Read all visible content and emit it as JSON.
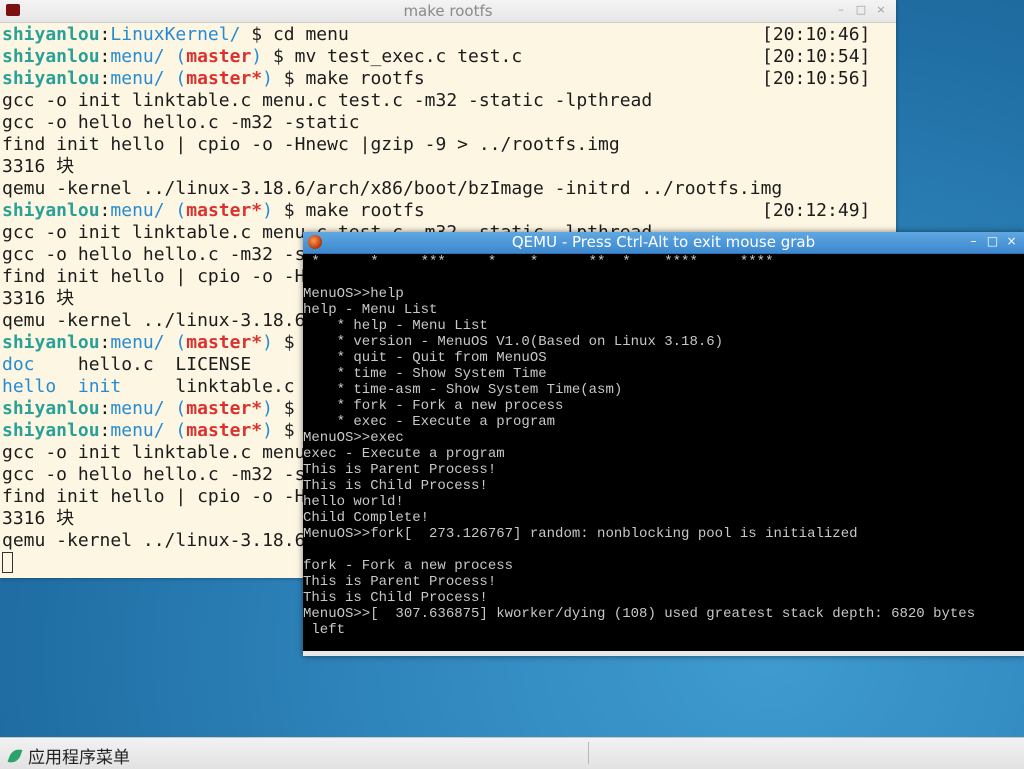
{
  "terminal": {
    "title": "make rootfs",
    "buttons": {
      "minimize": "–",
      "maximize": "□",
      "close": "×"
    },
    "lines": [
      {
        "segs": [
          {
            "t": "shiyanlou",
            "c": "green"
          },
          {
            "t": ":",
            "c": "plain"
          },
          {
            "t": "LinuxKernel/",
            "c": "blue"
          },
          {
            "t": " $ cd menu",
            "c": "plain"
          }
        ],
        "ts": "[20:10:46]"
      },
      {
        "segs": [
          {
            "t": "shiyanlou",
            "c": "green"
          },
          {
            "t": ":",
            "c": "plain"
          },
          {
            "t": "menu/",
            "c": "blue"
          },
          {
            "t": " (",
            "c": "blue"
          },
          {
            "t": "master",
            "c": "red"
          },
          {
            "t": ")",
            "c": "blue"
          },
          {
            "t": " $ mv test_exec.c test.c",
            "c": "plain"
          }
        ],
        "ts": "[20:10:54]"
      },
      {
        "segs": [
          {
            "t": "shiyanlou",
            "c": "green"
          },
          {
            "t": ":",
            "c": "plain"
          },
          {
            "t": "menu/",
            "c": "blue"
          },
          {
            "t": " (",
            "c": "blue"
          },
          {
            "t": "master*",
            "c": "red"
          },
          {
            "t": ")",
            "c": "blue"
          },
          {
            "t": " $ make rootfs",
            "c": "plain"
          }
        ],
        "ts": "[20:10:56]"
      },
      {
        "segs": [
          {
            "t": "gcc -o init linktable.c menu.c test.c -m32 -static -lpthread",
            "c": "plain"
          }
        ]
      },
      {
        "segs": [
          {
            "t": "gcc -o hello hello.c -m32 -static",
            "c": "plain"
          }
        ]
      },
      {
        "segs": [
          {
            "t": "find init hello | cpio -o -Hnewc |gzip -9 > ../rootfs.img",
            "c": "plain"
          }
        ]
      },
      {
        "segs": [
          {
            "t": "3316 块",
            "c": "plain"
          }
        ]
      },
      {
        "segs": [
          {
            "t": "qemu -kernel ../linux-3.18.6/arch/x86/boot/bzImage -initrd ../rootfs.img",
            "c": "plain"
          }
        ]
      },
      {
        "segs": [
          {
            "t": "shiyanlou",
            "c": "green"
          },
          {
            "t": ":",
            "c": "plain"
          },
          {
            "t": "menu/",
            "c": "blue"
          },
          {
            "t": " (",
            "c": "blue"
          },
          {
            "t": "master*",
            "c": "red"
          },
          {
            "t": ")",
            "c": "blue"
          },
          {
            "t": " $ make rootfs",
            "c": "plain"
          }
        ],
        "ts": "[20:12:49]"
      },
      {
        "segs": [
          {
            "t": "gcc -o init linktable.c menu.c test.c -m32 -static -lpthread",
            "c": "plain"
          }
        ]
      },
      {
        "segs": [
          {
            "t": "gcc -o hello hello.c -m32 -static",
            "c": "plain"
          }
        ]
      },
      {
        "segs": [
          {
            "t": "find init hello | cpio -o -Hnewc |gzip -9 > ../rootfs.img",
            "c": "plain"
          }
        ]
      },
      {
        "segs": [
          {
            "t": "3316 块",
            "c": "plain"
          }
        ]
      },
      {
        "segs": [
          {
            "t": "qemu -kernel ../linux-3.18.6/arch/x86/boot/bzImage -initrd ../rootfs.img",
            "c": "plain"
          }
        ]
      },
      {
        "segs": [
          {
            "t": "shiyanlou",
            "c": "green"
          },
          {
            "t": ":",
            "c": "plain"
          },
          {
            "t": "menu/",
            "c": "blue"
          },
          {
            "t": " (",
            "c": "blue"
          },
          {
            "t": "master*",
            "c": "red"
          },
          {
            "t": ")",
            "c": "blue"
          },
          {
            "t": " $ ls",
            "c": "plain"
          }
        ]
      },
      {
        "segs": [
          {
            "t": "doc",
            "c": "blue"
          },
          {
            "t": "    hello.c  LICENSE",
            "c": "plain"
          }
        ]
      },
      {
        "segs": [
          {
            "t": "hello",
            "c": "blue"
          },
          {
            "t": "  ",
            "c": "plain"
          },
          {
            "t": "init",
            "c": "blue"
          },
          {
            "t": "     linktable.c",
            "c": "plain"
          }
        ]
      },
      {
        "segs": [
          {
            "t": "shiyanlou",
            "c": "green"
          },
          {
            "t": ":",
            "c": "plain"
          },
          {
            "t": "menu/",
            "c": "blue"
          },
          {
            "t": " (",
            "c": "blue"
          },
          {
            "t": "master*",
            "c": "red"
          },
          {
            "t": ")",
            "c": "blue"
          },
          {
            "t": " $ ",
            "c": "plain"
          }
        ]
      },
      {
        "segs": [
          {
            "t": "shiyanlou",
            "c": "green"
          },
          {
            "t": ":",
            "c": "plain"
          },
          {
            "t": "menu/",
            "c": "blue"
          },
          {
            "t": " (",
            "c": "blue"
          },
          {
            "t": "master*",
            "c": "red"
          },
          {
            "t": ")",
            "c": "blue"
          },
          {
            "t": " $ make rootfs",
            "c": "plain"
          }
        ]
      },
      {
        "segs": [
          {
            "t": "gcc -o init linktable.c menu.c test.c -m32 -static -lpthread",
            "c": "plain"
          }
        ]
      },
      {
        "segs": [
          {
            "t": "gcc -o hello hello.c -m32 -static",
            "c": "plain"
          }
        ]
      },
      {
        "segs": [
          {
            "t": "find init hello | cpio -o -Hnewc |gzip -9 > ../rootfs.img",
            "c": "plain"
          }
        ]
      },
      {
        "segs": [
          {
            "t": "3316 块",
            "c": "plain"
          }
        ]
      },
      {
        "segs": [
          {
            "t": "qemu -kernel ../linux-3.18.6/arch/x86/boot/bzImage -initrd ../rootfs.img",
            "c": "plain"
          }
        ]
      }
    ]
  },
  "qemu": {
    "title": "QEMU - Press Ctrl-Alt to exit mouse grab",
    "buttons": {
      "minimize": "–",
      "maximize": "□",
      "close": "×"
    },
    "lines": [
      " *      *     ***     *    *      **  *    ****     ****",
      "",
      "MenuOS>>help",
      "help - Menu List",
      "    * help - Menu List",
      "    * version - MenuOS V1.0(Based on Linux 3.18.6)",
      "    * quit - Quit from MenuOS",
      "    * time - Show System Time",
      "    * time-asm - Show System Time(asm)",
      "    * fork - Fork a new process",
      "    * exec - Execute a program",
      "MenuOS>>exec",
      "exec - Execute a program",
      "This is Parent Process!",
      "This is Child Process!",
      "hello world!",
      "Child Complete!",
      "MenuOS>>fork[  273.126767] random: nonblocking pool is initialized",
      "",
      "fork - Fork a new process",
      "This is Parent Process!",
      "This is Child Process!",
      "MenuOS>>[  307.636875] kworker/dying (108) used greatest stack depth: 6820 bytes",
      " left",
      "",
      "_"
    ]
  },
  "panel": {
    "menu_label": "应用程序菜单"
  }
}
